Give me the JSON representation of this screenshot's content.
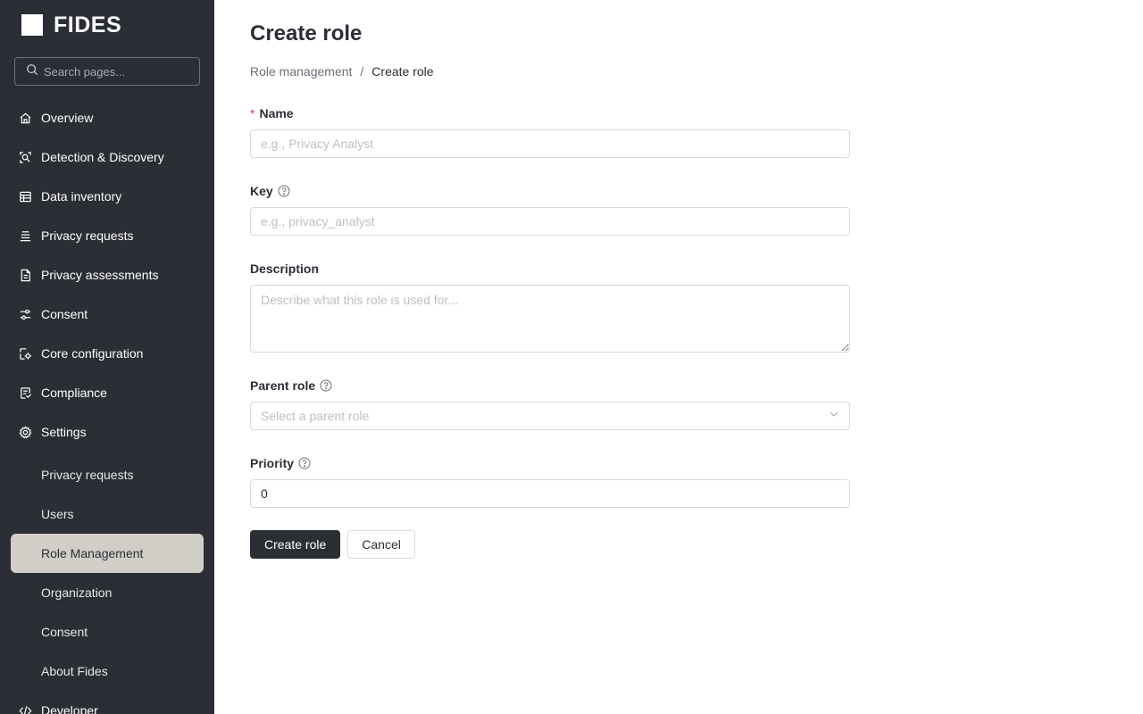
{
  "brand": {
    "name": "FIDES"
  },
  "search": {
    "placeholder": "Search pages..."
  },
  "nav": {
    "items": [
      {
        "label": "Overview",
        "icon": "home-icon"
      },
      {
        "label": "Detection & Discovery",
        "icon": "scan-search-icon"
      },
      {
        "label": "Data inventory",
        "icon": "database-table-icon"
      },
      {
        "label": "Privacy requests",
        "icon": "list-stack-icon"
      },
      {
        "label": "Privacy assessments",
        "icon": "document-icon"
      },
      {
        "label": "Consent",
        "icon": "sliders-icon"
      },
      {
        "label": "Core configuration",
        "icon": "config-icon"
      },
      {
        "label": "Compliance",
        "icon": "compliance-shield-icon"
      },
      {
        "label": "Settings",
        "icon": "gear-icon"
      }
    ],
    "settings_sub": [
      {
        "label": "Privacy requests"
      },
      {
        "label": "Users"
      },
      {
        "label": "Role Management",
        "active": true
      },
      {
        "label": "Organization"
      },
      {
        "label": "Consent"
      },
      {
        "label": "About Fides"
      }
    ],
    "developer": {
      "label": "Developer",
      "icon": "code-icon"
    }
  },
  "page": {
    "title": "Create role",
    "breadcrumb": {
      "parent": "Role management",
      "separator": "/",
      "current": "Create role"
    }
  },
  "form": {
    "name": {
      "label": "Name",
      "required_mark": "*",
      "placeholder": "e.g., Privacy Analyst",
      "value": ""
    },
    "key": {
      "label": "Key",
      "placeholder": "e.g., privacy_analyst",
      "value": ""
    },
    "description": {
      "label": "Description",
      "placeholder": "Describe what this role is used for...",
      "value": ""
    },
    "parent_role": {
      "label": "Parent role",
      "placeholder": "Select a parent role"
    },
    "priority": {
      "label": "Priority",
      "value": "0"
    },
    "submit_label": "Create role",
    "cancel_label": "Cancel"
  },
  "colors": {
    "sidebar_bg": "#2b2e35",
    "active_item_bg": "#d1cdc7",
    "primary_button": "#2b2e35",
    "required": "#e0424b"
  }
}
